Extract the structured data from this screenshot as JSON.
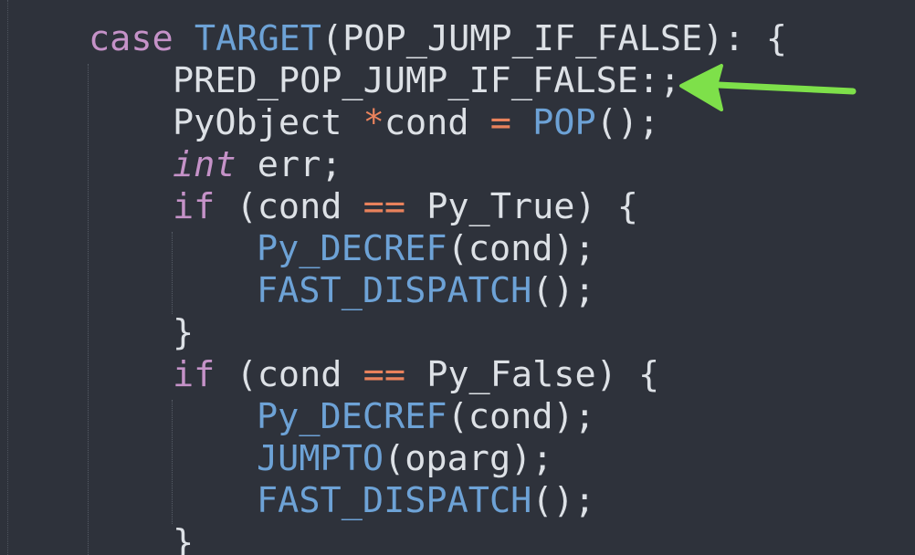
{
  "code": {
    "line1": {
      "kw": "case",
      "fn": "TARGET",
      "p1": "(",
      "arg": "POP_JUMP_IF_FALSE",
      "p2": ")",
      "rest": ": {"
    },
    "line2": {
      "text": "PRED_POP_JUMP_IF_FALSE",
      "colon": ":",
      "semi": ";"
    },
    "line3": {
      "type": "PyObject",
      "star": "*",
      "name": "cond",
      "eq": "=",
      "fn": "POP",
      "rest": "();"
    },
    "line4": {
      "type": "int",
      "rest": "err;"
    },
    "line5": {
      "kw": "if",
      "p1": "(cond",
      "op": "==",
      "rest": "Py_True) {"
    },
    "line6": {
      "fn": "Py_DECREF",
      "rest": "(cond);"
    },
    "line7": {
      "fn": "FAST_DISPATCH",
      "rest": "();"
    },
    "line8": {
      "text": "}"
    },
    "line9": {
      "kw": "if",
      "p1": "(cond",
      "op": "==",
      "rest": "Py_False) {"
    },
    "line10": {
      "fn": "Py_DECREF",
      "rest": "(cond);"
    },
    "line11": {
      "fn": "JUMPTO",
      "rest": "(oparg);"
    },
    "line12": {
      "fn": "FAST_DISPATCH",
      "rest": "();"
    },
    "line13": {
      "text": "}"
    }
  },
  "colors": {
    "background": "#2e323b",
    "text": "#dde1e6",
    "keyword": "#c592c8",
    "function": "#6da2d6",
    "operator": "#e9825c",
    "arrow": "#7ee04a"
  },
  "annotation": {
    "icon": "green-arrow-icon"
  }
}
